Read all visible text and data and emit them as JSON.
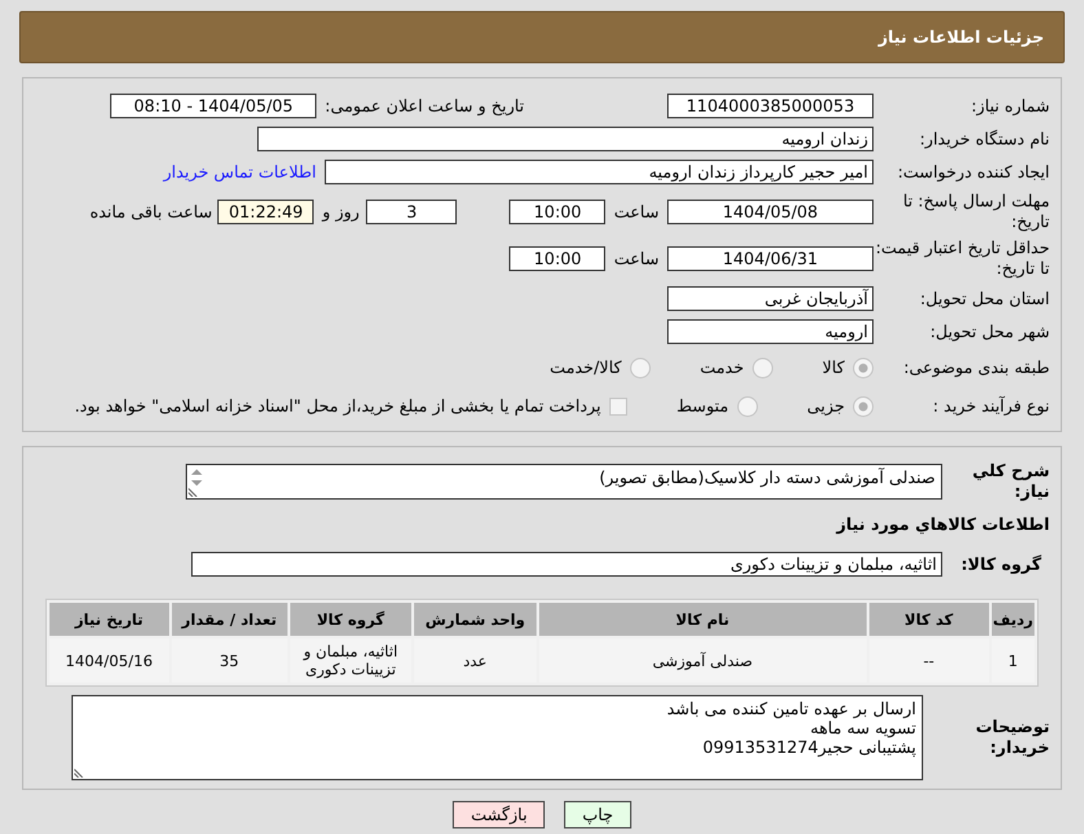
{
  "header": {
    "title": "جزئیات اطلاعات نیاز"
  },
  "need_number": {
    "label": "شماره نیاز:",
    "value": "1104000385000053"
  },
  "announce": {
    "label": "تاریخ و ساعت اعلان عمومی:",
    "value": "1404/05/05 - 08:10"
  },
  "buyer_org": {
    "label": "نام دستگاه خریدار:",
    "value": "زندان ارومیه"
  },
  "requester": {
    "label": "ایجاد کننده درخواست:",
    "value": "امیر حجیر کارپرداز زندان ارومیه",
    "link": "اطلاعات تماس خریدار"
  },
  "reply_deadline": {
    "label": "مهلت ارسال پاسخ: تا تاریخ:",
    "date": "1404/05/08",
    "time_label": "ساعت",
    "time": "10:00",
    "days": "3",
    "days_label": "روز و",
    "remaining": "01:22:49",
    "remaining_label": "ساعت باقی مانده"
  },
  "price_validity": {
    "label": "حداقل تاریخ اعتبار قیمت: تا تاریخ:",
    "date": "1404/06/31",
    "time_label": "ساعت",
    "time": "10:00"
  },
  "province": {
    "label": "استان محل تحویل:",
    "value": "آذربایجان غربی"
  },
  "city": {
    "label": "شهر محل تحویل:",
    "value": "ارومیه"
  },
  "category": {
    "label": "طبقه بندی موضوعی:",
    "options": [
      {
        "label": "کالا",
        "selected": true
      },
      {
        "label": "خدمت",
        "selected": false
      },
      {
        "label": "کالا/خدمت",
        "selected": false
      }
    ]
  },
  "process": {
    "label": "نوع فرآیند خرید :",
    "options": [
      {
        "label": "جزیی",
        "selected": true
      },
      {
        "label": "متوسط",
        "selected": false
      }
    ],
    "treasury": {
      "label": "پرداخت تمام یا بخشی از مبلغ خرید،از محل \"اسناد خزانه اسلامی\" خواهد بود.",
      "checked": false
    }
  },
  "description": {
    "label": "شرح کلي نياز:",
    "value": "صندلی آموزشی  دسته دار کلاسیک(مطابق تصویر)"
  },
  "goods_heading": "اطلاعات کالاهاي مورد نياز",
  "goods_group": {
    "label": "گروه کالا:",
    "value": "اثاثیه، مبلمان و تزیینات دکوری"
  },
  "table": {
    "columns": [
      "ردیف",
      "کد کالا",
      "نام کالا",
      "واحد شمارش",
      "گروه کالا",
      "تعداد / مقدار",
      "تاریخ نیاز"
    ],
    "rows": [
      [
        "1",
        "--",
        "صندلی آموزشی",
        "عدد",
        "اثاثیه، مبلمان و تزیینات دکوری",
        "35",
        "1404/05/16"
      ]
    ]
  },
  "buyer_notes": {
    "label": "توضیحات خریدار:",
    "lines": [
      "ارسال بر عهده تامین کننده می باشد",
      "تسویه سه ماهه",
      "پشتیبانی حجیر09913531274"
    ]
  },
  "buttons": [
    {
      "label": "چاپ",
      "kind": "print"
    },
    {
      "label": "بازگشت",
      "kind": "back"
    }
  ]
}
